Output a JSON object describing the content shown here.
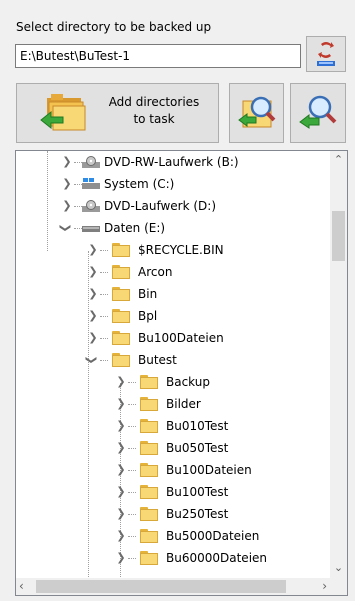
{
  "header": {
    "label": "Select directory to be backed up",
    "path_value": "E:\\Butest\\BuTest-1"
  },
  "buttons": {
    "add_directories_line1": "Add directories",
    "add_directories_line2": "to task"
  },
  "tree": {
    "drives": [
      {
        "label": "DVD-RW-Laufwerk (B:)",
        "icon": "dvd-drive-icon"
      },
      {
        "label": "System (C:)",
        "icon": "system-drive-icon"
      },
      {
        "label": "DVD-Laufwerk (D:)",
        "icon": "dvd-drive-icon"
      },
      {
        "label": "Daten (E:)",
        "icon": "hard-drive-icon",
        "expanded": true
      }
    ],
    "level1": [
      {
        "label": "$RECYCLE.BIN"
      },
      {
        "label": "Arcon"
      },
      {
        "label": "Bin"
      },
      {
        "label": "Bpl"
      },
      {
        "label": "Bu100Dateien"
      },
      {
        "label": "Butest",
        "expanded": true
      }
    ],
    "level2": [
      {
        "label": "Backup"
      },
      {
        "label": "Bilder"
      },
      {
        "label": "Bu010Test"
      },
      {
        "label": "Bu050Test"
      },
      {
        "label": "Bu100Dateien"
      },
      {
        "label": "Bu100Test"
      },
      {
        "label": "Bu250Test"
      },
      {
        "label": "Bu5000Dateien"
      },
      {
        "label": "Bu60000Dateien"
      }
    ]
  },
  "colors": {
    "folder": "#f8d775",
    "green_arrow": "#3aa83a"
  }
}
